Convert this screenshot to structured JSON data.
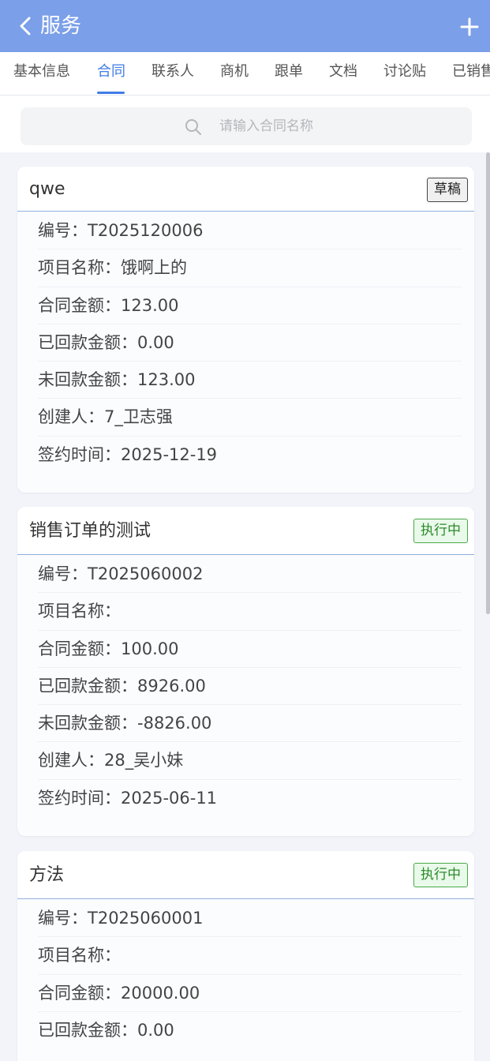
{
  "header": {
    "title": "服务"
  },
  "tabs": [
    "基本信息",
    "合同",
    "联系人",
    "商机",
    "跟单",
    "文档",
    "讨论贴",
    "已销售"
  ],
  "active_tab": "合同",
  "search": {
    "placeholder": "请输入合同名称"
  },
  "contracts": [
    {
      "title": "qwe",
      "status": "草稿",
      "rows": [
        "编号：T2025120006",
        "项目名称：饿啊上的",
        "合同金额：123.00",
        "已回款金额：0.00",
        "未回款金额：123.00",
        "创建人：7_卫志强",
        "签约时间：2025-12-19"
      ]
    },
    {
      "title": "销售订单的测试",
      "status": "执行中",
      "rows": [
        "编号：T2025060002",
        "项目名称：",
        "合同金额：100.00",
        "已回款金额：8926.00",
        "未回款金额：-8826.00",
        "创建人：28_吴小妹",
        "签约时间：2025-06-11"
      ]
    },
    {
      "title": "方法",
      "status": "执行中",
      "rows": [
        "编号：T2025060001",
        "项目名称：",
        "合同金额：20000.00",
        "已回款金额：0.00"
      ]
    }
  ],
  "colors": {
    "header": "#7b9fe8",
    "accent": "#3f7ce6",
    "status_active": "#2a8a2a"
  }
}
